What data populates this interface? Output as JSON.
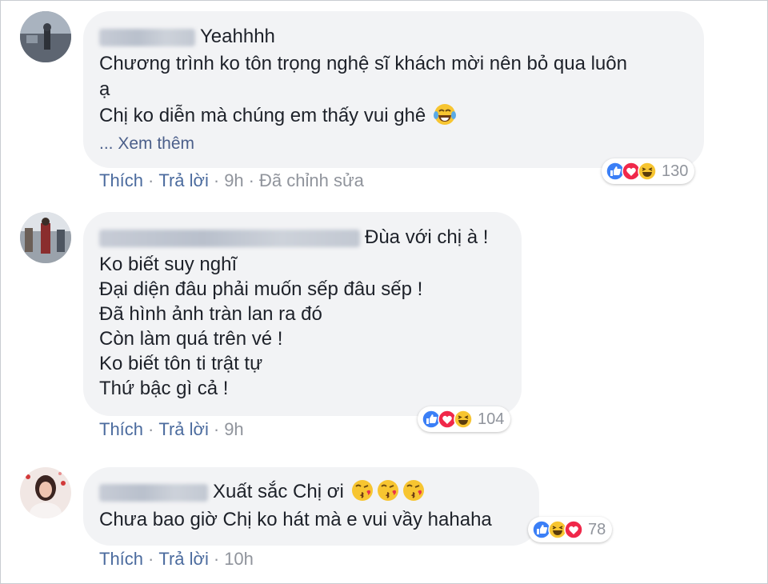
{
  "comments": [
    {
      "first_line": "Yeahhhh",
      "lines": [
        "Chương trình ko tôn trọng nghệ sĩ khách mời nên bỏ qua luôn",
        "ạ",
        "Chị ko diễn mà chúng em thấy vui ghê"
      ],
      "see_more": "... Xem thêm",
      "like": "Thích",
      "reply": "Trả lời",
      "time": "9h",
      "edited": "Đã chỉnh sửa",
      "reaction_count": "130"
    },
    {
      "first_line": "Đùa với chị à !",
      "lines": [
        "Ko biết suy nghĩ",
        "Đại diện đâu phải muốn sếp đâu sếp !",
        "Đã hình ảnh tràn lan ra đó",
        "Còn làm quá trên vé !",
        "Ko biết tôn ti trật tự",
        "Thứ bậc gì cả !"
      ],
      "like": "Thích",
      "reply": "Trả lời",
      "time": "9h",
      "reaction_count": "104"
    },
    {
      "first_line": "Xuất sắc Chị ơi",
      "lines": [
        "Chưa bao giờ Chị ko hát mà e vui vầy hahaha"
      ],
      "like": "Thích",
      "reply": "Trả lời",
      "time": "10h",
      "reaction_count": "78"
    }
  ],
  "separator": "·",
  "colors": {
    "link": "#4b6b9e",
    "meta": "#90949c",
    "bubble": "#f2f3f5",
    "like_blue": "#3b7ff6",
    "love_red": "#f0284a",
    "haha_yellow": "#f7c531"
  },
  "icons": [
    "like-reaction-icon",
    "love-reaction-icon",
    "haha-reaction-icon",
    "tears-of-joy-emoji",
    "kissing-heart-emoji"
  ]
}
